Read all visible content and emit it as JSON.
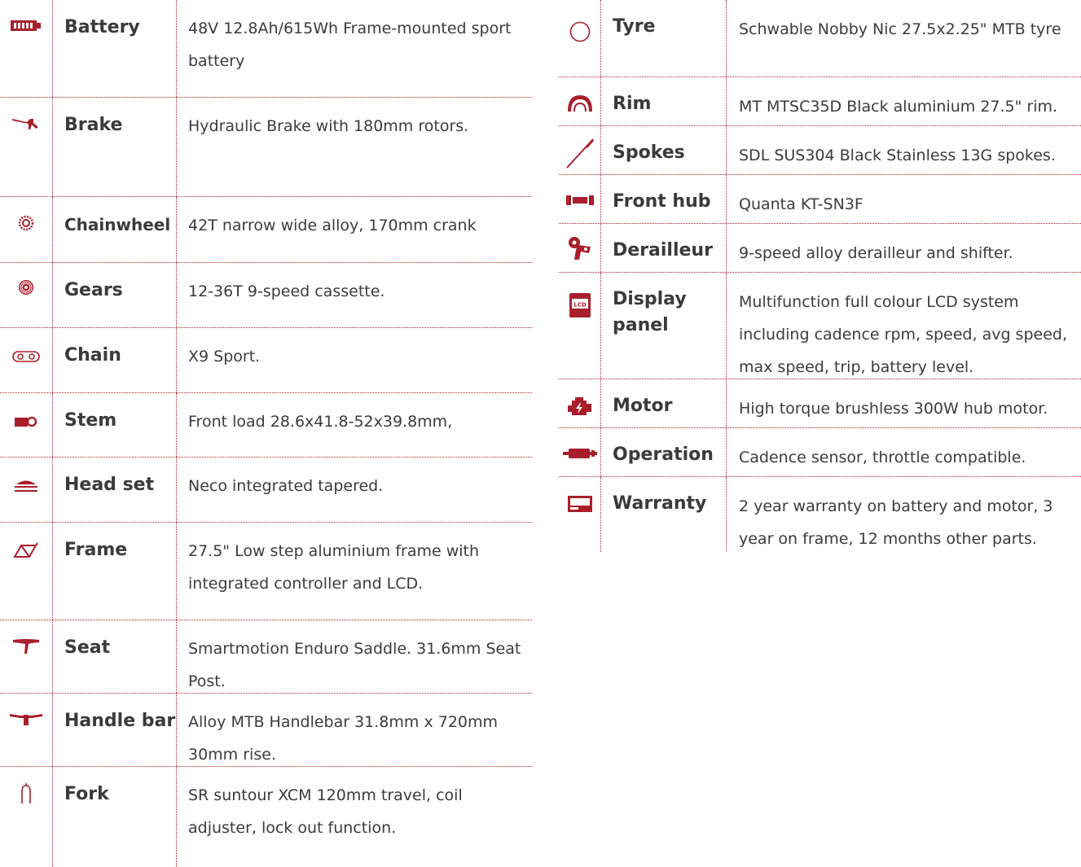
{
  "left": [
    {
      "icon": "battery-icon",
      "name": "Battery",
      "value": "48V 12.8Ah/615Wh Frame-mounted sport battery"
    },
    {
      "icon": "brake-lever-icon",
      "name": "Brake",
      "value": "Hydraulic Brake with 180mm rotors."
    },
    {
      "icon": "chainwheel-icon",
      "name": "Chainwheel",
      "value": "42T narrow wide alloy, 170mm crank"
    },
    {
      "icon": "cassette-icon",
      "name": "Gears",
      "value": " 12-36T 9-speed cassette."
    },
    {
      "icon": "chain-icon",
      "name": "Chain",
      "value": "X9 Sport."
    },
    {
      "icon": "stem-icon",
      "name": "Stem",
      "value": "Front load 28.6x41.8-52x39.8mm,"
    },
    {
      "icon": "headset-icon",
      "name": "Head set",
      "value": "Neco integrated tapered."
    },
    {
      "icon": "frame-icon",
      "name": "Frame",
      "value": "27.5\" Low step aluminium frame with integrated controller and LCD."
    },
    {
      "icon": "seat-icon",
      "name": "Seat",
      "value": "Smartmotion Enduro Saddle. 31.6mm Seat Post."
    },
    {
      "icon": "handlebar-icon",
      "name": "Handle bar",
      "value": "Alloy MTB Handlebar 31.8mm x 720mm 30mm rise."
    },
    {
      "icon": "fork-icon",
      "name": "Fork",
      "value": "SR suntour XCM 120mm travel, coil adjuster, lock out function."
    }
  ],
  "right": [
    {
      "icon": "tyre-icon",
      "name": "Tyre",
      "value": "Schwable Nobby Nic 27.5x2.25\" MTB tyre"
    },
    {
      "icon": "rim-icon",
      "name": "Rim",
      "value": "MT MTSC35D Black aluminium 27.5\" rim."
    },
    {
      "icon": "spoke-icon",
      "name": "Spokes",
      "value": "SDL SUS304 Black Stainless 13G spokes."
    },
    {
      "icon": "hub-icon",
      "name": "Front hub",
      "value": "Quanta KT-SN3F"
    },
    {
      "icon": "derailleur-icon",
      "name": "Derailleur",
      "value": "9-speed alloy derailleur and shifter."
    },
    {
      "icon": "lcd-display-icon",
      "name": "Display panel",
      "value": "Multifunction full colour LCD system including cadence rpm, speed, avg speed, max speed, trip, battery level."
    },
    {
      "icon": "motor-icon",
      "name": "Motor",
      "value": "High torque brushless 300W hub motor."
    },
    {
      "icon": "operation-icon",
      "name": "Operation",
      "value": "Cadence sensor, throttle compatible."
    },
    {
      "icon": "warranty-icon",
      "name": "Warranty",
      "value": "2 year warranty on battery and motor, 3 year on frame, 12 months other parts."
    }
  ],
  "colors": {
    "accent": "#a81f2b",
    "text": "#3b3b3b"
  }
}
